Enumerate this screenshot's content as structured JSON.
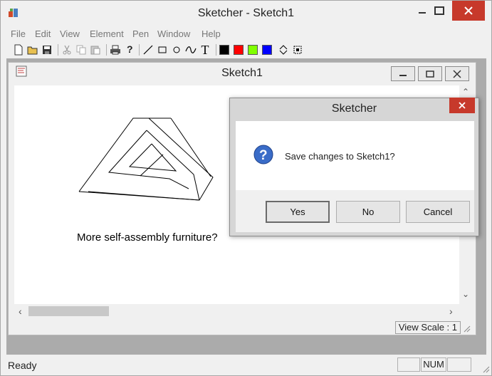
{
  "app": {
    "title": "Sketcher - Sketch1"
  },
  "menu": [
    "File",
    "Edit",
    "View",
    "Element",
    "Pen",
    "Window",
    "Help"
  ],
  "toolbar": {
    "buttons": [
      "new-icon",
      "open-icon",
      "save-icon",
      "cut-icon",
      "copy-icon",
      "paste-icon",
      "print-icon",
      "help-icon",
      "line-icon",
      "rectangle-icon",
      "circle-icon",
      "curve-icon",
      "text-icon",
      "move-icon",
      "scale-icon"
    ],
    "text_tool_label": "T",
    "colors": [
      "#000000",
      "#ff0000",
      "#80ff00",
      "#0000ff"
    ]
  },
  "child": {
    "title": "Sketch1",
    "drawing_text": "More self-assembly furniture?",
    "view_scale": "View Scale : 1"
  },
  "dialog": {
    "title": "Sketcher",
    "message": "Save changes to Sketch1?",
    "buttons": {
      "yes": "Yes",
      "no": "No",
      "cancel": "Cancel"
    }
  },
  "status": {
    "text": "Ready",
    "num": "NUM"
  }
}
